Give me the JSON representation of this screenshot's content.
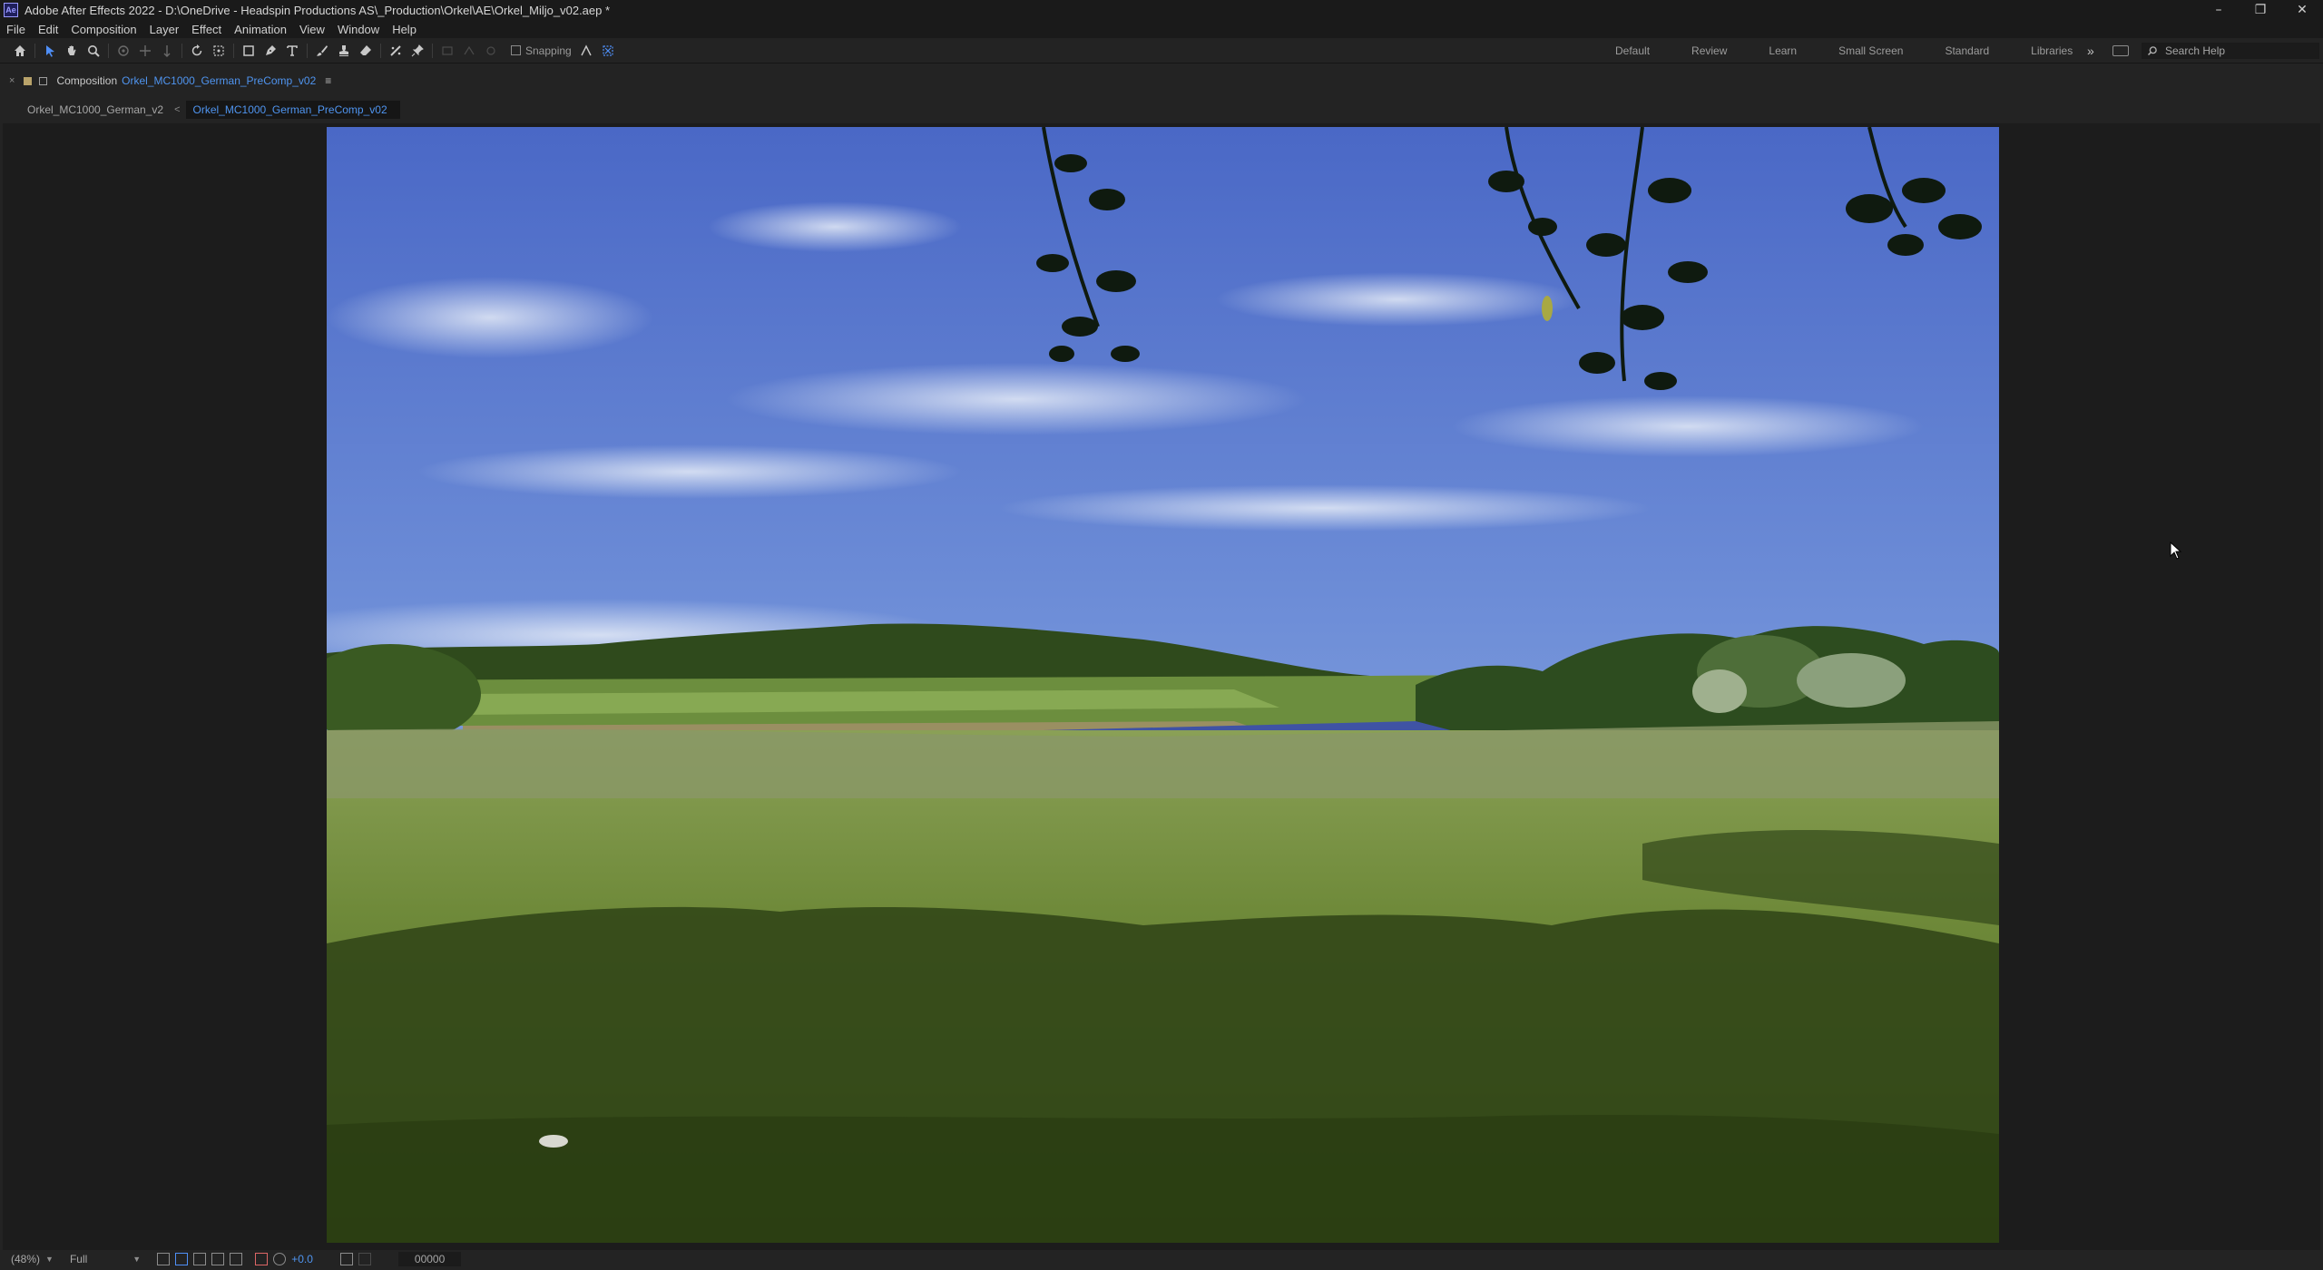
{
  "app": {
    "title": "Adobe After Effects 2022 - D:\\OneDrive - Headspin Productions AS\\_Production\\Orkel\\AE\\Orkel_Miljo_v02.aep *",
    "icon_label": "Ae"
  },
  "window_controls": {
    "minimize": "–",
    "restore": "❐",
    "close": "✕"
  },
  "menu": [
    "File",
    "Edit",
    "Composition",
    "Layer",
    "Effect",
    "Animation",
    "View",
    "Window",
    "Help"
  ],
  "toolbar": {
    "tools": [
      "home-icon",
      "selection-icon",
      "hand-icon",
      "zoom-icon",
      "orbit-camera-icon",
      "pan-camera-icon",
      "dolly-camera-icon",
      "rotation-icon",
      "pan-behind-icon",
      "rectangle-icon",
      "pen-icon",
      "type-icon",
      "brush-icon",
      "clone-stamp-icon",
      "eraser-icon",
      "roto-brush-icon",
      "puppet-pin-icon"
    ],
    "snapping_label": "Snapping",
    "accent": "#4f8ff7"
  },
  "workspaces": [
    "Default",
    "Review",
    "Learn",
    "Small Screen",
    "Standard",
    "Libraries"
  ],
  "search_help": {
    "placeholder": "Search Help"
  },
  "panel": {
    "label": "Composition",
    "comp_name": "Orkel_MC1000_German_PreComp_v02",
    "menu_glyph": "≡"
  },
  "breadcrumbs": {
    "parent": "Orkel_MC1000_German_v2",
    "arrow": "<",
    "current": "Orkel_MC1000_German_PreComp_v02"
  },
  "viewer_controls": {
    "magnification": "(48%)",
    "resolution": "Full",
    "exposure": "+0.0",
    "timecode": "00000"
  }
}
